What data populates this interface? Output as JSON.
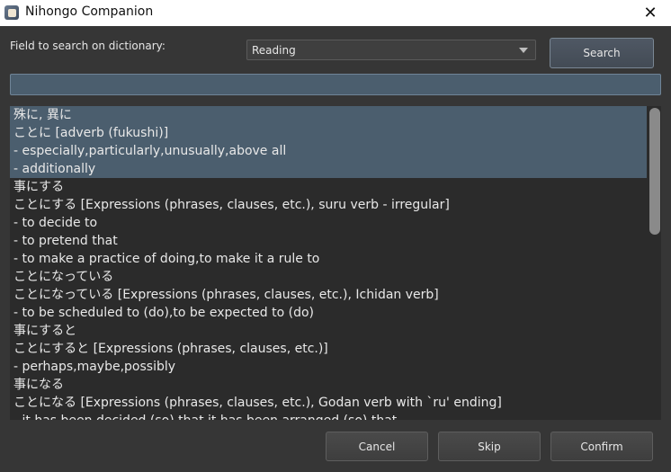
{
  "window": {
    "title": "Nihongo Companion",
    "close_glyph": "✕"
  },
  "search": {
    "field_label": "Field to search on dictionary:",
    "field_selected": "Reading",
    "button_label": "Search",
    "input_value": ""
  },
  "results": [
    {
      "selected": true,
      "lines": [
        "殊に, 異に",
        "ことに [adverb (fukushi)]",
        " - especially,particularly,unusually,above all",
        " - additionally"
      ]
    },
    {
      "selected": false,
      "lines": [
        "事にする",
        "ことにする [Expressions (phrases, clauses, etc.), suru verb - irregular]",
        " - to decide to",
        " - to pretend that",
        " - to make a practice of doing,to make it a rule to"
      ]
    },
    {
      "selected": false,
      "lines": [
        "ことになっている",
        "ことになっている [Expressions (phrases, clauses, etc.), Ichidan verb]",
        " - to be scheduled to (do),to be expected to (do)"
      ]
    },
    {
      "selected": false,
      "lines": [
        "事にすると",
        "ことにすると [Expressions (phrases, clauses, etc.)]",
        " - perhaps,maybe,possibly"
      ]
    },
    {
      "selected": false,
      "lines": [
        "事になる",
        "ことになる [Expressions (phrases, clauses, etc.), Godan verb with `ru' ending]",
        " - it has been decided (so) that,it has been arranged (so) that"
      ]
    }
  ],
  "footer": {
    "cancel_label": "Cancel",
    "skip_label": "Skip",
    "confirm_label": "Confirm"
  }
}
